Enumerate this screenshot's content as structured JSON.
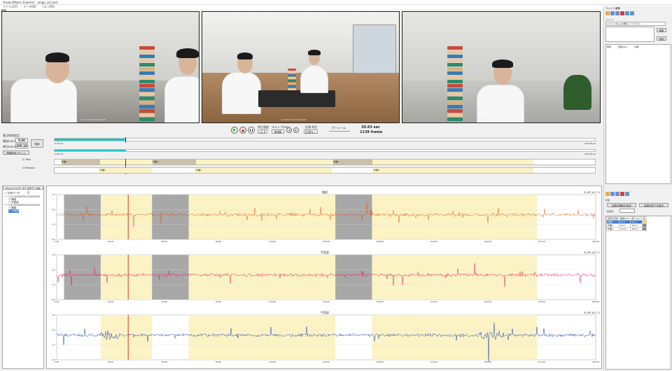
{
  "window": {
    "title": "ProductMetric Explorer - jenga_vid_test",
    "sub_title": "動画",
    "minimize": "—",
    "maximize": "□",
    "close": "✕"
  },
  "menu": [
    "ファイル(F)",
    "データ(D)",
    "ヘルプ(H)"
  ],
  "videos": [
    {
      "label": "1/1   00:00:00 / 00:09:24"
    },
    {
      "label": "1/1   00:00:00 / 00:09:24"
    },
    {
      "label": "1/1   00:00:00 / 00:09:24"
    }
  ],
  "controls": {
    "group_title": "基点時刻設定",
    "start_label": "開始(sec)",
    "start_value": "0.00",
    "scale_label": "単位(sec)",
    "scale_value": "295.10",
    "apply_button": "適用",
    "reset_button": "同期時刻リセット",
    "speed_label": "再生速度",
    "speed_value": "x1.0",
    "skip_label": "スキップ(sec)",
    "skip_value": "0.03",
    "section_label": "区間 再生",
    "section_value": "区間なし",
    "volume_label": "ボリューム",
    "time_sec": "30.63 sec",
    "time_frame": "1139 frame",
    "range_start": "0.00 sec",
    "range_end": "294.08 sec",
    "play_icon": "▶",
    "stop_icon": "■",
    "pause_icon": "❚❚",
    "prev_icon": "◀",
    "next_icon": "▶"
  },
  "timeline": {
    "row1_label": "Task",
    "row2_label": "Remark",
    "row1_blocks": [
      "作業1",
      "作業2",
      "作業3"
    ],
    "row2_blocks": [
      "作業1",
      "作業2",
      "作業3"
    ]
  },
  "tree": {
    "tab1": "プロジェクト/データ",
    "tab2": "表示データ設定",
    "nodes": [
      "ー 計測データ",
      "ー ☐ A_20200930170451000",
      "   ☐ 胸部",
      "   ☐ 手首部",
      "ー ☐ B_20200930170451000",
      "   ☐ 胸部",
      "   ☑ 手首部"
    ]
  },
  "chart_data": [
    {
      "type": "line",
      "title": "胸部",
      "legend": "B_WP_ACC_X",
      "color": "#e05a1a",
      "ylim": [
        -2.0,
        1.0
      ],
      "yticks": [
        "1.0",
        "0.0",
        "-1.0",
        "-2.0"
      ],
      "xticks": [
        "0.00",
        "30.00",
        "60.00",
        "90.00",
        "120.00",
        "150.00",
        "180.00",
        "210.00",
        "240.00",
        "270.00",
        "290.00"
      ],
      "xlim": [
        0,
        294
      ],
      "gray_regions": [
        [
          4,
          24
        ],
        [
          52,
          72
        ],
        [
          152,
          172
        ]
      ],
      "yellow_regions": [
        [
          24,
          52
        ],
        [
          72,
          152
        ],
        [
          172,
          262
        ]
      ],
      "cursor": 39
    },
    {
      "type": "line",
      "title": "手首部",
      "legend": "B_WP_ACC_Y",
      "color": "#e0245a",
      "ylim": [
        -2.0,
        1.0
      ],
      "yticks": [
        "1.0",
        "0.0",
        "-1.0",
        "-2.0"
      ],
      "xticks": [
        "0.00",
        "30.00",
        "60.00",
        "90.00",
        "120.00",
        "150.00",
        "180.00",
        "210.00",
        "240.00",
        "270.00",
        "290.00"
      ],
      "xlim": [
        0,
        294
      ],
      "gray_regions": [
        [
          4,
          24
        ],
        [
          52,
          72
        ],
        [
          152,
          172
        ]
      ],
      "yellow_regions": [
        [
          24,
          52
        ],
        [
          72,
          152
        ],
        [
          172,
          262
        ]
      ],
      "cursor": 39
    },
    {
      "type": "line",
      "title": "手首部",
      "legend": "B_WP_ACC_Z",
      "color": "#1a3fb0",
      "ylim": [
        -3.0,
        2.0
      ],
      "yticks": [
        "2.0",
        "0.0",
        "-2.0",
        "-3.0"
      ],
      "xticks": [
        "0.00",
        "30.00",
        "60.00",
        "90.00",
        "120.00",
        "150.00",
        "180.00",
        "210.00",
        "240.00",
        "270.00",
        "290.00"
      ],
      "xlim": [
        0,
        294
      ],
      "gray_regions": [],
      "yellow_regions": [
        [
          24,
          52
        ],
        [
          72,
          152
        ],
        [
          172,
          262
        ]
      ],
      "cursor": 39
    }
  ],
  "right_panel": {
    "title": "コメント編集",
    "search_label": "コメント",
    "search_placeholder": "(コメントを入力/選択してください)",
    "edit_button": "更新",
    "add_button": "追加",
    "list_headers": [
      "時刻",
      "区間(sec)",
      "内容"
    ],
    "section_title": "区間",
    "section_btn1": "区間の開始を設定",
    "section_btn2": "区間の終了を設定",
    "color_label": "区間色",
    "table_headers": [
      "区間の名前",
      "開始(sec)",
      "終了(sec)",
      "色"
    ],
    "table_rows": [
      [
        "作業1",
        "24.3",
        "53.1",
        ""
      ],
      [
        "作業2",
        "76.2",
        "153.1",
        ""
      ],
      [
        "作業3",
        "174.8",
        "262.0",
        ""
      ]
    ]
  }
}
